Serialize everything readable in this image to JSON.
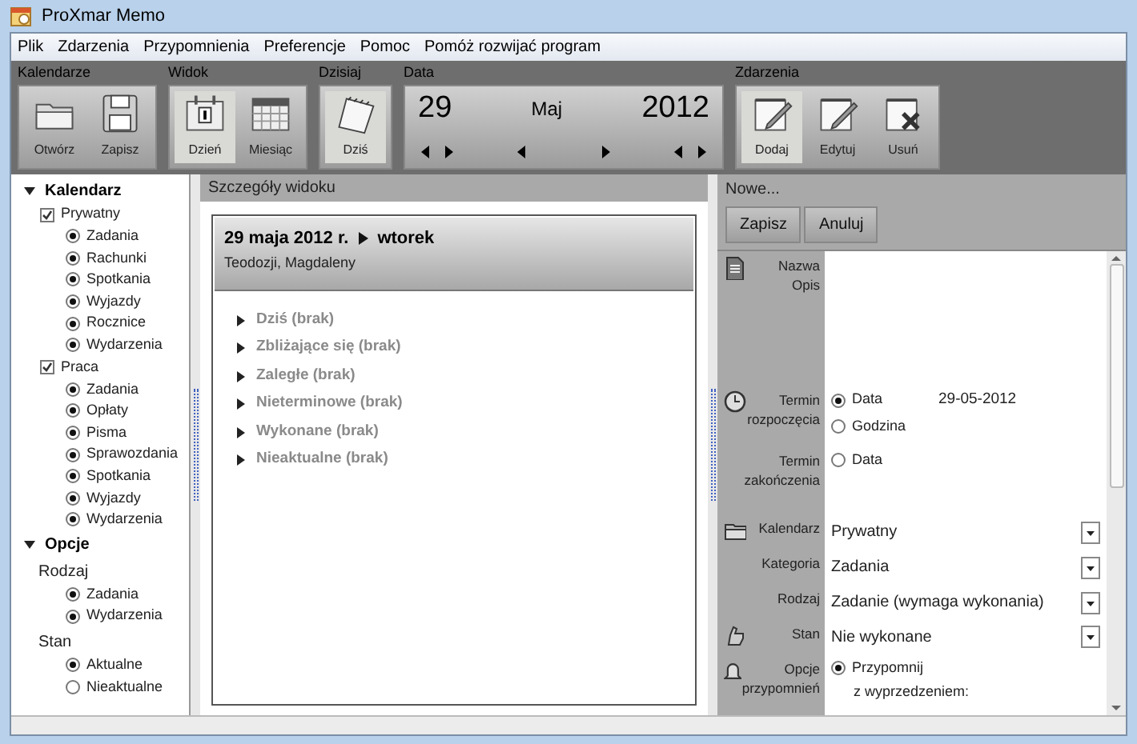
{
  "window": {
    "title": "ProXmar Memo"
  },
  "menu": [
    "Plik",
    "Zdarzenia",
    "Przypomnienia",
    "Preferencje",
    "Pomoc",
    "Pomóż rozwijać program"
  ],
  "toolbar": [
    {
      "kind": "buttons",
      "label": "Kalendarze",
      "buttons": [
        {
          "label": "Otwórz",
          "selected": false
        },
        {
          "label": "Zapisz",
          "selected": false
        }
      ]
    },
    {
      "kind": "buttons",
      "label": "Widok",
      "buttons": [
        {
          "label": "Dzień",
          "selected": true
        },
        {
          "label": "Miesiąc",
          "selected": false
        }
      ]
    },
    {
      "kind": "buttons",
      "label": "Dzisiaj",
      "buttons": [
        {
          "label": "Dziś",
          "selected": true
        }
      ]
    },
    {
      "kind": "date",
      "label": "Data",
      "day": "29",
      "month": "Maj",
      "year": "2012"
    },
    {
      "kind": "buttons",
      "label": "Zdarzenia",
      "buttons": [
        {
          "label": "Dodaj",
          "selected": true
        },
        {
          "label": "Edytuj",
          "selected": false
        },
        {
          "label": "Usuń",
          "selected": false
        }
      ]
    }
  ],
  "sidebar": {
    "sections": [
      {
        "title": "Kalendarz",
        "expanded": true,
        "groups": [
          {
            "kind": "checkbox",
            "label": "Prywatny",
            "checked": true,
            "items": [
              {
                "label": "Zadania",
                "checked": true
              },
              {
                "label": "Rachunki",
                "checked": true
              },
              {
                "label": "Spotkania",
                "checked": true
              },
              {
                "label": "Wyjazdy",
                "checked": true
              },
              {
                "label": "Rocznice",
                "checked": true
              },
              {
                "label": "Wydarzenia",
                "checked": true
              }
            ]
          },
          {
            "kind": "checkbox",
            "label": "Praca",
            "checked": true,
            "items": [
              {
                "label": "Zadania",
                "checked": true
              },
              {
                "label": "Opłaty",
                "checked": true
              },
              {
                "label": "Pisma",
                "checked": true
              },
              {
                "label": "Sprawozdania",
                "checked": true
              },
              {
                "label": "Spotkania",
                "checked": true
              },
              {
                "label": "Wyjazdy",
                "checked": true
              },
              {
                "label": "Wydarzenia",
                "checked": true
              }
            ]
          }
        ]
      },
      {
        "title": "Opcje",
        "expanded": true,
        "groups": [
          {
            "kind": "heading",
            "label": "Rodzaj",
            "items": [
              {
                "label": "Zadania",
                "checked": true
              },
              {
                "label": "Wydarzenia",
                "checked": true
              }
            ]
          },
          {
            "kind": "heading",
            "label": "Stan",
            "items": [
              {
                "label": "Aktualne",
                "checked": true
              },
              {
                "label": "Nieaktualne",
                "checked": false
              }
            ]
          }
        ]
      }
    ]
  },
  "details": {
    "header": "Szczegóły widoku",
    "date": "29 maja 2012 r.",
    "weekday": "wtorek",
    "names": "Teodozji, Magdaleny",
    "sections": [
      {
        "label": "Dziś (brak)",
        "expanded": false
      },
      {
        "label": "Zbliżające się (brak)",
        "expanded": false
      },
      {
        "label": "Zaległe (brak)",
        "expanded": false
      },
      {
        "label": "Nieterminowe (brak)",
        "expanded": false
      },
      {
        "label": "Wykonane (brak)",
        "expanded": false
      },
      {
        "label": "Nieaktualne (brak)",
        "expanded": false
      }
    ]
  },
  "editor": {
    "title": "Nowe...",
    "buttons": [
      "Zapisz",
      "Anuluj"
    ],
    "rows": [
      {
        "kind": "text",
        "labels": [
          "Nazwa",
          "Opis"
        ]
      },
      {
        "kind": "radios",
        "label": "Termin rozpoczęcia",
        "options": [
          {
            "label": "Data",
            "selected": true,
            "value": "29-05-2012"
          },
          {
            "label": "Godzina",
            "selected": false
          }
        ]
      },
      {
        "kind": "radios",
        "label": "Termin zakończenia",
        "options": [
          {
            "label": "Data",
            "selected": false
          }
        ]
      },
      {
        "kind": "select",
        "label": "Kalendarz",
        "value": "Prywatny"
      },
      {
        "kind": "select",
        "label": "Kategoria",
        "value": "Zadania"
      },
      {
        "kind": "select",
        "label": "Rodzaj",
        "value": "Zadanie (wymaga wykonania)"
      },
      {
        "kind": "select",
        "label": "Stan",
        "value": "Nie wykonane"
      },
      {
        "kind": "radios",
        "label": "Opcje przypomnień",
        "options": [
          {
            "label": "Przypomnij",
            "selected": true,
            "note": "z wyprzedzeniem:"
          }
        ]
      }
    ]
  }
}
